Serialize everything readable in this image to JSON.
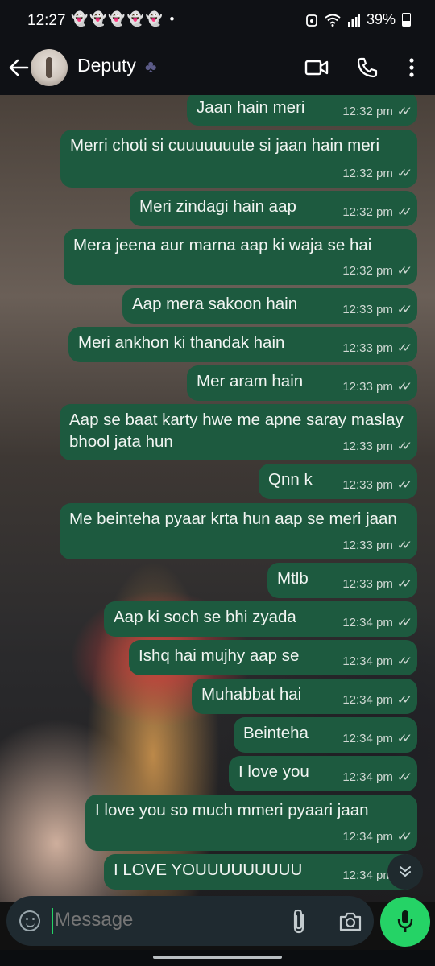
{
  "status_bar": {
    "time": "12:27",
    "notif_icons": "👻👻👻👻👻 •",
    "battery": "39%"
  },
  "header": {
    "contact_name": "Deputy",
    "badge": "♣"
  },
  "messages": [
    {
      "text": "Jaan hain meri",
      "time": "12:32 pm"
    },
    {
      "text": "Merri choti si cuuuuuuute si jaan hain meri",
      "time": "12:32 pm"
    },
    {
      "text": "Meri zindagi hain aap",
      "time": "12:32 pm"
    },
    {
      "text": "Mera jeena aur marna aap ki waja se hai",
      "time": "12:32 pm"
    },
    {
      "text": "Aap mera sakoon hain",
      "time": "12:33 pm"
    },
    {
      "text": "Meri ankhon ki thandak hain",
      "time": "12:33 pm"
    },
    {
      "text": "Mer aram hain",
      "time": "12:33 pm"
    },
    {
      "text": "Aap se baat karty hwe me apne saray maslay bhool jata hun",
      "time": "12:33 pm"
    },
    {
      "text": "Qnn k",
      "time": "12:33 pm"
    },
    {
      "text": "Me beinteha pyaar krta hun aap se meri jaan",
      "time": "12:33 pm"
    },
    {
      "text": "Mtlb",
      "time": "12:33 pm"
    },
    {
      "text": "Aap ki soch se bhi zyada",
      "time": "12:34 pm"
    },
    {
      "text": "Ishq hai mujhy aap se",
      "time": "12:34 pm"
    },
    {
      "text": "Muhabbat hai",
      "time": "12:34 pm"
    },
    {
      "text": "Beinteha",
      "time": "12:34 pm"
    },
    {
      "text": "I love you",
      "time": "12:34 pm"
    },
    {
      "text": "I love you so much mmeri pyaari jaan",
      "time": "12:34 pm"
    },
    {
      "text": "I LOVE YOUUUUUUUUU",
      "time": "12:34 pm"
    }
  ],
  "composer": {
    "placeholder": "Message"
  },
  "colors": {
    "bubble": "#1d5a3f",
    "accent": "#25d366",
    "header": "#0f1115"
  },
  "icons": [
    "back-arrow-icon",
    "video-call-icon",
    "phone-icon",
    "more-vert-icon",
    "emoji-icon",
    "attach-icon",
    "camera-icon",
    "mic-icon",
    "chevron-down-icon"
  ]
}
